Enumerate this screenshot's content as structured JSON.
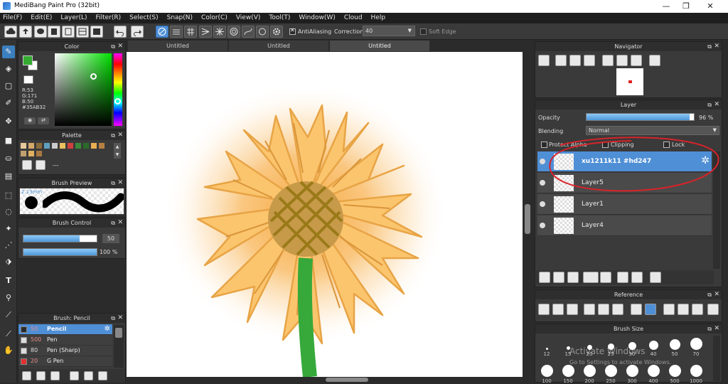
{
  "window": {
    "title": "MediBang Paint Pro (32bit)",
    "minimize": "—",
    "maximize": "❐",
    "close": "✕"
  },
  "menu": [
    "File(F)",
    "Edit(E)",
    "Layer(L)",
    "Filter(R)",
    "Select(S)",
    "Snap(N)",
    "Color(C)",
    "View(V)",
    "Tool(T)",
    "Window(W)",
    "Cloud",
    "Help"
  ],
  "toolbar": {
    "antialiasing_label": "AntiAliasing",
    "correction_label": "Correction",
    "correction_value": "40",
    "soft_edge_label": "Soft Edge"
  },
  "color_panel": {
    "title": "Color",
    "r": "R:53",
    "g": "G:171",
    "b": "B:50",
    "hex": "#35AB32",
    "fg_color": "#35AB32",
    "bg_color": "#ffffff"
  },
  "palette_panel": {
    "title": "Palette",
    "swatches": [
      "#e8c89a",
      "#d6a86a",
      "#8a6a3a",
      "#5fa0c0",
      "#ccc",
      "#e8c060",
      "#d04040",
      "#3a8a3a",
      "#2a6a2a",
      "#e8b050",
      "#b88040",
      "#c0a070",
      "#e0b060",
      "#a87840"
    ],
    "more_label": "---"
  },
  "brush_preview": {
    "title": "Brush Preview",
    "size_label": "2.13mm"
  },
  "brush_control": {
    "title": "Brush Control",
    "size_value": "50",
    "opacity_value": "100 %",
    "size_fraction": 0.77,
    "opacity_fraction": 1.0
  },
  "brush_list": {
    "title": "Brush: Pencil",
    "items": [
      {
        "size": "50",
        "name": "Pencil",
        "color": "#2a2a2a",
        "selected": true
      },
      {
        "size": "500",
        "name": "Pen",
        "color": "#ddd",
        "selected": false
      },
      {
        "size": "80",
        "name": "Pen (Sharp)",
        "color": "#ddd",
        "selected": false
      },
      {
        "size": "20",
        "name": "G Pen",
        "color": "#e03030",
        "selected": false
      }
    ]
  },
  "doc_tabs": [
    "Untitled",
    "Untitled",
    "Untitled"
  ],
  "navigator": {
    "title": "Navigator"
  },
  "layer_panel": {
    "title": "Layer",
    "opacity_label": "Opacity",
    "opacity_value": "96 %",
    "opacity_fraction": 0.96,
    "blending_label": "Blending",
    "blending_value": "Normal",
    "protect_alpha_label": "Protect Alpha",
    "clipping_label": "Clipping",
    "lock_label": "Lock",
    "layers": [
      {
        "name": "xu1211k11 #hd247",
        "selected": true
      },
      {
        "name": "Layer5",
        "selected": false
      },
      {
        "name": "Layer1",
        "selected": false
      },
      {
        "name": "Layer4",
        "selected": false
      }
    ]
  },
  "reference": {
    "title": "Reference"
  },
  "brush_size": {
    "title": "Brush Size",
    "sizes": [
      "12",
      "15",
      "20",
      "25",
      "30",
      "40",
      "50",
      "70"
    ],
    "sizes_row2": [
      "100",
      "150",
      "200",
      "250",
      "300",
      "400",
      "500",
      "1000"
    ]
  },
  "watermark": {
    "line1": "Activate Windows",
    "line2": "Go to Settings to activate Windows."
  }
}
